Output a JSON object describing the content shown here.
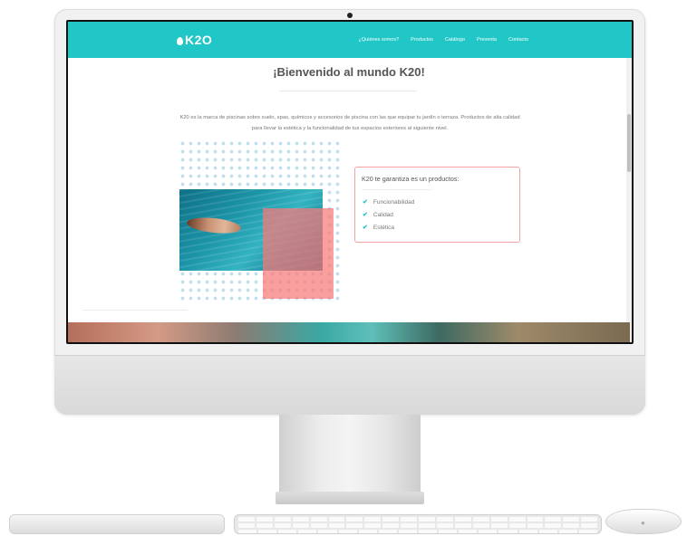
{
  "site": {
    "logo": "K2O",
    "nav": [
      {
        "label": "¿Quiénes somos?"
      },
      {
        "label": "Productos"
      },
      {
        "label": "Catálogo"
      },
      {
        "label": "Preventa"
      },
      {
        "label": "Contacto"
      }
    ],
    "title": "¡Bienvenido al mundo K20!",
    "intro_line1": "K20 es la marca de piscinas sobre suelo, spas, químicos y accesorios de piscina con las que equipar tu jardín o terraza. Productos de",
    "intro_line2": "alta calidad para llevar la estética y la funcionalidad de tus espacios exteriores al siguiente nivel.",
    "card": {
      "title": "K20 te garantiza es un productos:",
      "items": [
        {
          "label": "Funcionabilidad"
        },
        {
          "label": "Calidad"
        },
        {
          "label": "Estética"
        }
      ]
    }
  },
  "colors": {
    "header": "#21c6c7",
    "accent_pink": "#f87878",
    "card_border": "#f3a3a3"
  },
  "icons": {
    "check": "check-icon",
    "drop": "water-drop-icon"
  }
}
